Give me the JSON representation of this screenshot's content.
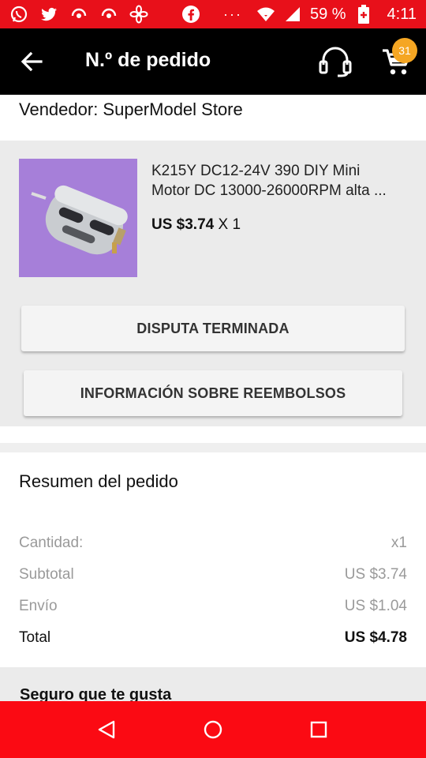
{
  "status_bar": {
    "battery_percent": "59 %",
    "time": "4:11",
    "dots": "···",
    "icons": [
      "whatsapp-icon",
      "twitter-icon",
      "hotspot-icon",
      "hotspot-icon",
      "fan-icon",
      "facebook-icon",
      "wifi-icon",
      "signal-icon",
      "battery-icon"
    ]
  },
  "app_bar": {
    "title": "N.º de pedido",
    "cart_badge": "31",
    "icons": [
      "back-arrow-icon",
      "headset-icon",
      "cart-icon"
    ]
  },
  "vendor": "Vendedor: SuperModel Store",
  "product": {
    "name_line1": "K215Y DC12-24V 390 DIY Mini",
    "name_line2": "Motor DC 13000-26000RPM alta ...",
    "price": "US $3.74",
    "quantity": "X 1",
    "image_background": "#a67fd9"
  },
  "actions": {
    "dispute": "DISPUTA TERMINADA",
    "refund_info": "INFORMACIÓN SOBRE REEMBOLSOS"
  },
  "summary": {
    "title": "Resumen del pedido",
    "rows": [
      {
        "label": "Cantidad:",
        "value": "x1"
      },
      {
        "label": "Subtotal",
        "value": "US $3.74"
      },
      {
        "label": "Envío",
        "value": "US $1.04"
      },
      {
        "label": "Total",
        "value": "US $4.78"
      }
    ]
  },
  "recommend_title": "Seguro que te gusta",
  "colors": {
    "status_bar": "#e8101a",
    "app_bar": "#000000",
    "badge": "#f5a623",
    "nav_bar": "#fb0a13"
  }
}
